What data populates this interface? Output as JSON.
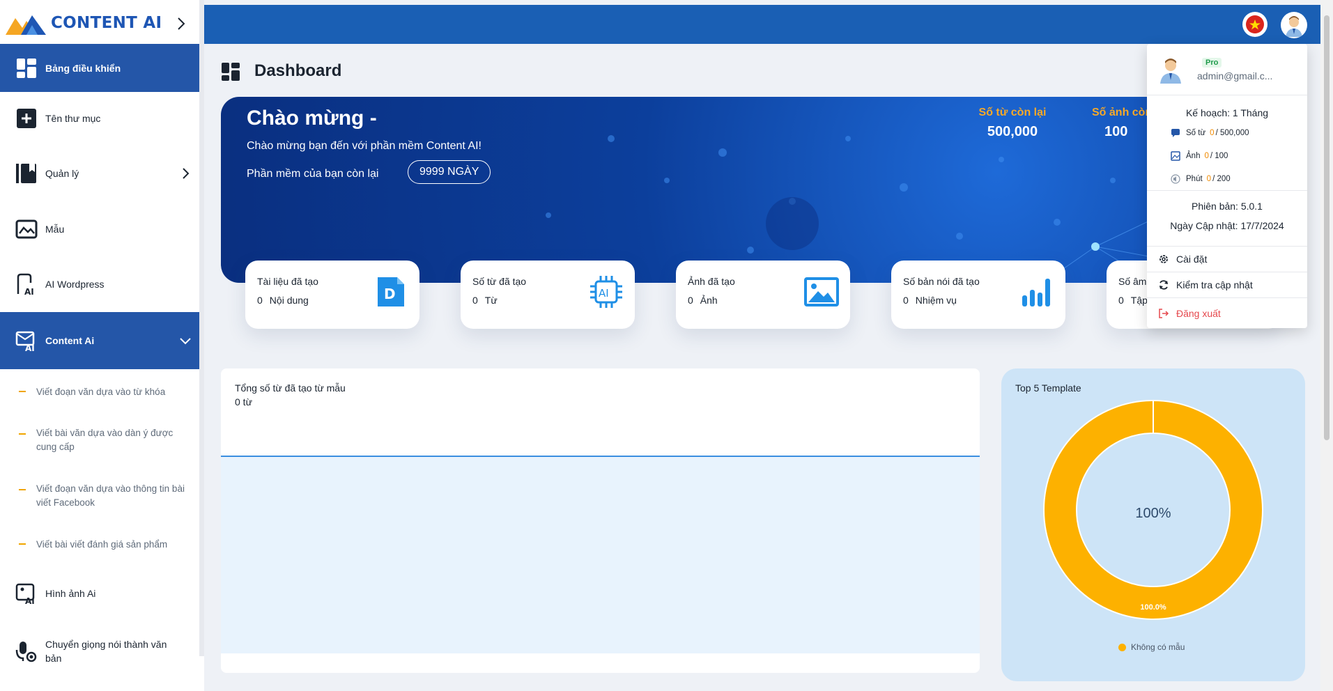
{
  "app": {
    "logo_text": "CONTENT AI"
  },
  "sidebar": {
    "items": [
      {
        "label": "Bảng điều khiển",
        "icon": "dashboard-icon"
      },
      {
        "label": "Tên thư mục",
        "icon": "add-folder-icon"
      },
      {
        "label": "Quản lý",
        "icon": "bookmark-icon"
      },
      {
        "label": "Mẫu",
        "icon": "template-image-icon"
      },
      {
        "label": "AI Wordpress",
        "icon": "ai-wordpress-icon"
      },
      {
        "label": "Content Ai",
        "icon": "ai-mail-icon"
      },
      {
        "label": "Hình ảnh Ai",
        "icon": "ai-image-icon"
      },
      {
        "label": "Chuyển giọng nói thành văn bản",
        "icon": "microphone-icon"
      }
    ],
    "sub_items": [
      "Viết đoạn văn dựa vào từ khóa",
      "Viết bài văn dựa vào dàn ý được cung cấp",
      "Viết đoạn văn dựa vào thông tin bài viết Facebook",
      "Viết bài viết đánh giá sản phẩm"
    ]
  },
  "page": {
    "title": "Dashboard"
  },
  "banner": {
    "title": "Chào mừng -",
    "subtitle": "Chào mừng bạn đến với phần mềm Content AI!",
    "remaining_label": "Phần mềm của bạn còn lại",
    "days_badge": "9999 NGÀY",
    "stats": [
      {
        "label": "Số từ còn lại",
        "value": "500,000"
      },
      {
        "label": "Số ảnh còn lại",
        "value": "100"
      }
    ]
  },
  "cards": [
    {
      "title": "Tài liệu đã tạo",
      "count": "0",
      "unit": "Nội dung",
      "icon": "document-d-icon"
    },
    {
      "title": "Số từ đã tạo",
      "count": "0",
      "unit": "Từ",
      "icon": "ai-chip-icon"
    },
    {
      "title": "Ảnh đã tạo",
      "count": "0",
      "unit": "Ảnh",
      "icon": "image-icon"
    },
    {
      "title": "Số bản nói đã tạo",
      "count": "0",
      "unit": "Nhiệm vụ",
      "icon": "bar-chart-icon"
    },
    {
      "title": "Số âm",
      "count": "0",
      "unit": "Tập",
      "icon": "audio-icon"
    }
  ],
  "words_chart": {
    "title": "Tổng số từ đã tạo từ mẫu",
    "value": "0 từ"
  },
  "top5": {
    "title": "Top 5 Template",
    "center_label": "100%",
    "slice_label": "100.0%",
    "legend": "Không có mẫu"
  },
  "chart_data": {
    "type": "pie",
    "title": "Top 5 Template",
    "categories": [
      "Không có mẫu"
    ],
    "values": [
      100
    ],
    "colors": [
      "#fdb100"
    ]
  },
  "user_menu": {
    "badge": "Pro",
    "email": "admin@gmail.c...",
    "plan": "Kế hoạch: 1 Tháng",
    "quotas": [
      {
        "label": "Số từ",
        "used": "0",
        "total": "/ 500,000",
        "icon": "chat-icon"
      },
      {
        "label": "Ảnh",
        "used": "0",
        "total": "/ 100",
        "icon": "picture-icon"
      },
      {
        "label": "Phút",
        "used": "0",
        "total": "/ 200",
        "icon": "sound-icon"
      }
    ],
    "version": "Phiên bản: 5.0.1",
    "updated": "Ngày Cập nhật: 17/7/2024",
    "settings": "Cài đặt",
    "check_update": "Kiểm tra cập nhật",
    "logout": "Đăng xuất"
  },
  "colors": {
    "primary": "#1a5fb4",
    "active_nav": "#2456a8",
    "accent": "#f7a928",
    "donut": "#fdb100"
  }
}
